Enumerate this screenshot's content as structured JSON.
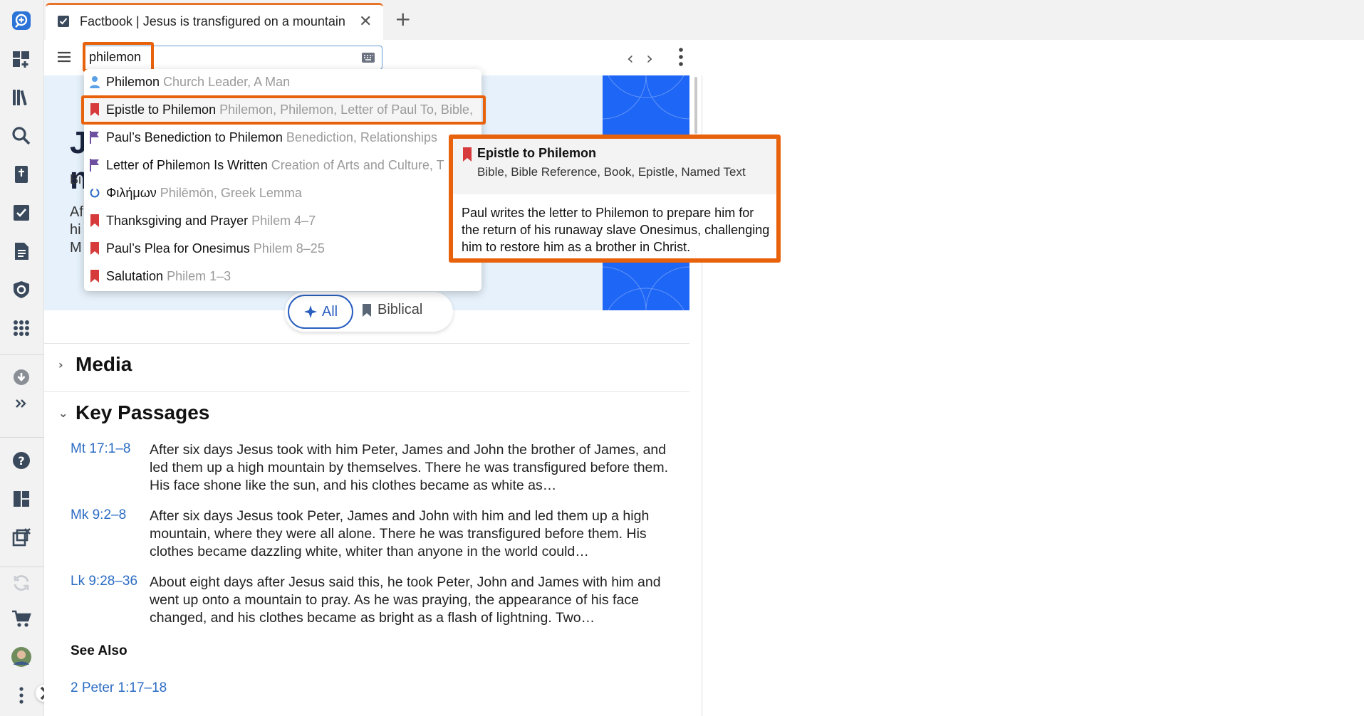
{
  "tab": {
    "title": "Factbook | Jesus is transfigured on a mountain",
    "close": "✕",
    "new": "+"
  },
  "search": {
    "query": "philemon"
  },
  "nav": {
    "back": "‹",
    "forward": "›"
  },
  "banner": {
    "big_line1": "J",
    "big_line2": "n",
    "sub": "Bi",
    "desc_l1": "Af",
    "desc_l2": "hi",
    "desc_l3": "M"
  },
  "filters": {
    "all": "All",
    "biblical": "Biblical"
  },
  "sections": {
    "media": "Media",
    "key_passages": "Key Passages",
    "see_also": "See Also"
  },
  "passages": [
    {
      "ref": "Mt 17:1–8",
      "text": "After six days Jesus took with him Peter, James and John the brother of James, and led them up a high mountain by themselves. There he was transfigured before them. His face shone like the sun, and his clothes became as white as…"
    },
    {
      "ref": "Mk 9:2–8",
      "text": "After six days Jesus took Peter, James and John with him and led them up a high mountain, where they were all alone. There he was transfigured before them. His clothes became dazzling white, whiter than anyone in the world could…"
    },
    {
      "ref": "Lk 9:28–36",
      "text": "About eight days after Jesus said this, he took Peter, John and James with him and went up onto a mountain to pray. As he was praying, the appearance of his face changed, and his clothes became as bright as a flash of lightning. Two…"
    }
  ],
  "see_also_link": "2 Peter 1:17–18",
  "dropdown": [
    {
      "name": "Philemon",
      "desc": "Church Leader, A Man",
      "icon": "person-icon"
    },
    {
      "name": "Epistle to Philemon",
      "desc": "Philemon, Philemon, Letter of Paul To, Bible,",
      "icon": "red-bookmark-icon"
    },
    {
      "name": "Paul’s Benediction to Philemon",
      "desc": "Benediction, Relationships",
      "icon": "purple-flag-icon"
    },
    {
      "name": "Letter of Philemon Is Written",
      "desc": "Creation of Arts and Culture, T",
      "icon": "purple-flag-icon"
    },
    {
      "name": "Φιλήμων",
      "desc": "Philēmōn, Greek Lemma",
      "icon": "lemma-icon"
    },
    {
      "name": "Thanksgiving and Prayer",
      "desc": "Philem 4–7",
      "icon": "red-bookmark-icon"
    },
    {
      "name": "Paul’s Plea for Onesimus",
      "desc": "Philem 8–25",
      "icon": "red-bookmark-icon"
    },
    {
      "name": "Salutation",
      "desc": "Philem 1–3",
      "icon": "red-bookmark-icon"
    }
  ],
  "tooltip": {
    "title": "Epistle to Philemon",
    "categories": "Bible, Bible Reference, Book, Epistle, Named Text",
    "body": "Paul writes the letter to Philemon to prepare him for the return of his runaway slave Onesimus, challenging him to restore him as a brother in Christ."
  },
  "colors": {
    "accent": "#e8620c",
    "link": "#2b6cc4",
    "banner_bg": "#e6f1fb",
    "art_blue": "#1e66f5",
    "bookmark_red": "#d63a3a",
    "flag_purple": "#6f4fa0"
  }
}
